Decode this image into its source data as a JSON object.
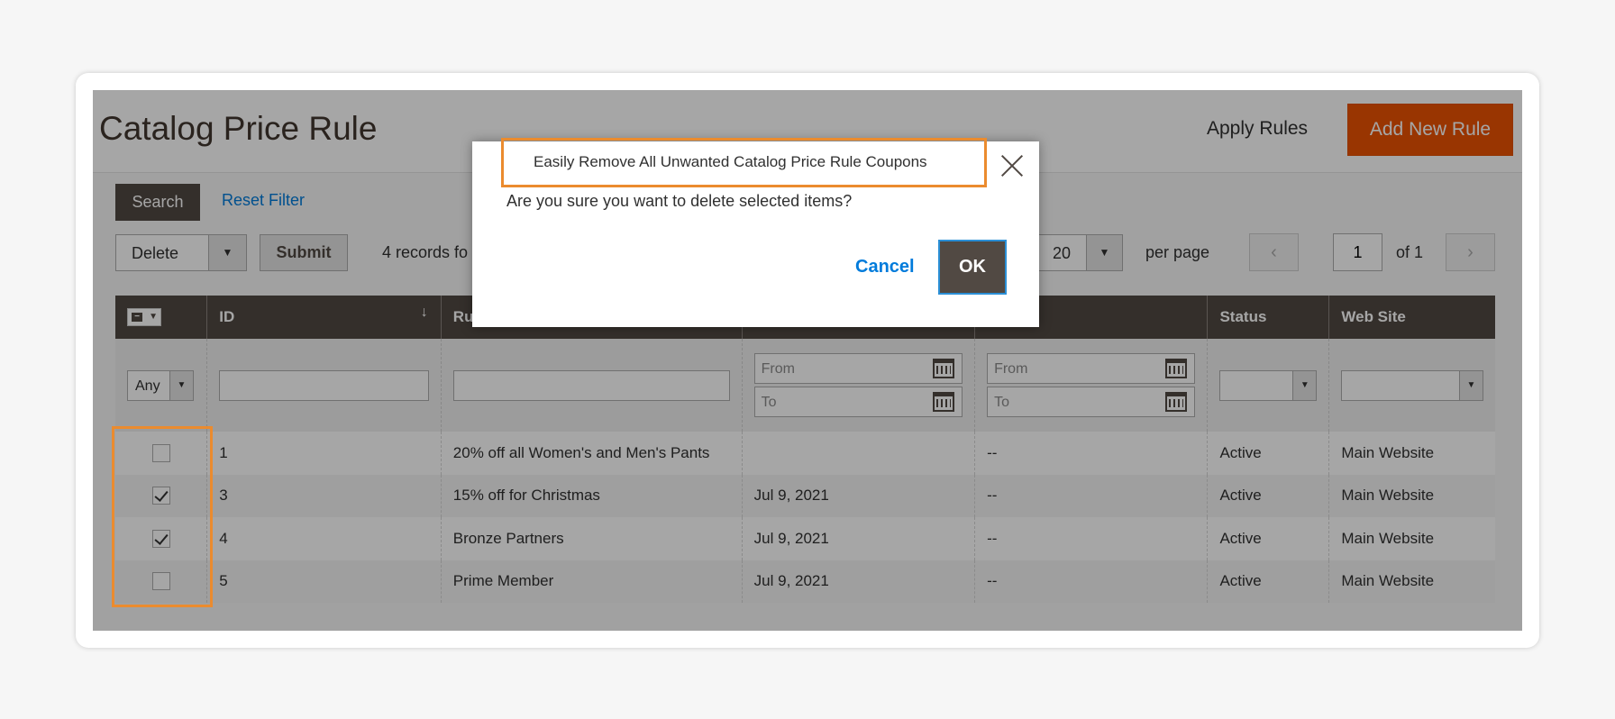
{
  "header": {
    "title": "Catalog Price Rule",
    "apply_rules_label": "Apply Rules",
    "add_new_rule_label": "Add New Rule",
    "add_new_rule_color": "#eb5202"
  },
  "toolbar": {
    "search_label": "Search",
    "reset_filter_label": "Reset Filter",
    "actions_selected": "Delete",
    "submit_label": "Submit",
    "records_found": "4 records fo",
    "per_page_value": "20",
    "per_page_label": "per page",
    "prev_icon": "‹",
    "next_icon": "›",
    "current_page": "1",
    "page_of": "of 1"
  },
  "grid": {
    "columns": [
      {
        "label": ""
      },
      {
        "label": "ID"
      },
      {
        "label": "Ru"
      },
      {
        "label": ""
      },
      {
        "label": ""
      },
      {
        "label": "Status"
      },
      {
        "label": "Web Site"
      }
    ],
    "sort_indicator": "↓",
    "filters": {
      "any_label": "Any",
      "from_placeholder": "From",
      "to_placeholder": "To"
    },
    "rows": [
      {
        "checked": false,
        "id": "1",
        "rule": "20% off all Women's and Men's Pants",
        "date": "",
        "to": "--",
        "status": "Active",
        "website": "Main Website"
      },
      {
        "checked": true,
        "id": "3",
        "rule": "15% off for Christmas",
        "date": "Jul 9, 2021",
        "to": "--",
        "status": "Active",
        "website": "Main Website"
      },
      {
        "checked": true,
        "id": "4",
        "rule": "Bronze Partners",
        "date": "Jul 9, 2021",
        "to": "--",
        "status": "Active",
        "website": "Main Website"
      },
      {
        "checked": false,
        "id": "5",
        "rule": "Prime Member",
        "date": "Jul 9, 2021",
        "to": "--",
        "status": "Active",
        "website": "Main Website"
      }
    ]
  },
  "modal": {
    "title": "Easily Remove All Unwanted Catalog Price Rule Coupons",
    "message": "Are you sure you want to delete selected items?",
    "cancel_label": "Cancel",
    "ok_label": "OK"
  },
  "highlight_color": "#eb8b2e"
}
